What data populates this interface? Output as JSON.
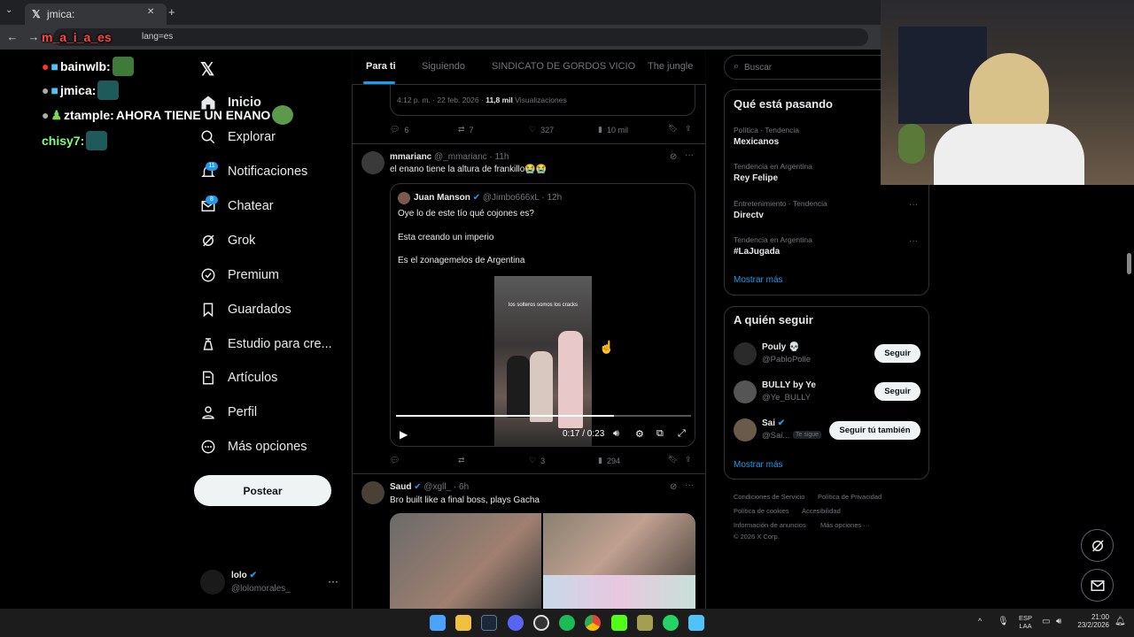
{
  "browser": {
    "tab_title": "jmica:",
    "url_fragment": "lang=es"
  },
  "chat": [
    {
      "user": "m_a_i_a_es",
      "color": "#ff4444",
      "message": ""
    },
    {
      "user": "bainwlb:",
      "color": "#ffffff",
      "message": ""
    },
    {
      "user": "jmica:",
      "color": "#ffffff",
      "message": ""
    },
    {
      "user": "ztample:",
      "color": "#ffffff",
      "message": "AHORA TIENE UN ENANO"
    },
    {
      "user": "chisy7:",
      "color": "#ffffff",
      "message": ""
    }
  ],
  "sidebar": {
    "items": [
      {
        "label": "Inicio",
        "icon": "home-icon"
      },
      {
        "label": "Explorar",
        "icon": "search-icon"
      },
      {
        "label": "Notificaciones",
        "icon": "bell-icon",
        "badge": "11"
      },
      {
        "label": "Chatear",
        "icon": "mail-icon",
        "badge": "8"
      },
      {
        "label": "Grok",
        "icon": "grok-icon"
      },
      {
        "label": "Premium",
        "icon": "premium-icon"
      },
      {
        "label": "Guardados",
        "icon": "bookmark-icon"
      },
      {
        "label": "Estudio para cre...",
        "icon": "studio-icon"
      },
      {
        "label": "Artículos",
        "icon": "articles-icon"
      },
      {
        "label": "Perfil",
        "icon": "person-icon"
      },
      {
        "label": "Más opciones",
        "icon": "more-icon"
      }
    ],
    "post_label": "Postear",
    "account": {
      "name": "lolo",
      "handle": "@lolomorales_"
    }
  },
  "feed_tabs": [
    "Para ti",
    "Siguiendo",
    "SINDICATO DE GORDOS VICIO",
    "The jungle"
  ],
  "tweet_prev": {
    "time": "4:12 p. m. · 22 feb. 2026",
    "views_count": "11,8 mil",
    "views_label": "Visualizaciones",
    "replies": "6",
    "reposts": "7",
    "likes": "327",
    "views": "10 mil"
  },
  "tweet1": {
    "name": "mmarianc",
    "handle": "@_mmarianc",
    "time": "· 11h",
    "text": "el enano tiene la altura de frankillo😭😭",
    "quote": {
      "name": "Juan Manson",
      "handle": "@Jimbo666xL",
      "time": "· 12h",
      "line1": "Oye lo de este tío qué cojones es?",
      "line2": "Esta creando un imperio",
      "line3": "Es el zonagemelos de Argentina",
      "video_caption": "los solteros somos los cracks",
      "video_time": "0:17 / 0:23",
      "progress": 0.74
    },
    "reposts": "",
    "likes": "3",
    "views": "294"
  },
  "tweet2": {
    "name": "Saud",
    "handle": "@xgll_",
    "time": "· 6h",
    "text": "Bro built like a final boss, plays Gacha"
  },
  "search": {
    "placeholder": "Buscar"
  },
  "trends": {
    "title": "Qué está pasando",
    "items": [
      {
        "category": "Política · Tendencia",
        "name": "Mexicanos"
      },
      {
        "category": "Tendencia en Argentina",
        "name": "Rey Felipe"
      },
      {
        "category": "Entretenimiento · Tendencia",
        "name": "Directv"
      },
      {
        "category": "Tendencia en Argentina",
        "name": "#LaJugada"
      }
    ],
    "show_more": "Mostrar más"
  },
  "who_to_follow": {
    "title": "A quién seguir",
    "items": [
      {
        "name": "Pouly 💀",
        "handle": "@PabloPolle",
        "button": "Seguir"
      },
      {
        "name": "BULLY by Ye",
        "handle": "@Ye_BULLY",
        "button": "Seguir"
      },
      {
        "name": "Sai",
        "handle": "@Sai...",
        "follows_you": "Te sigue",
        "button": "Seguir tú también"
      }
    ],
    "show_more": "Mostrar más"
  },
  "footer": {
    "links": [
      "Condiciones de Servicio",
      "Política de Privacidad",
      "Política de cookies",
      "Accesibilidad",
      "Información de anuncios",
      "Más opciones ···"
    ],
    "copyright": "© 2026 X Corp."
  },
  "taskbar": {
    "lang": "ESP",
    "lang2": "LAA",
    "time": "21:00",
    "date": "23/2/2026"
  }
}
